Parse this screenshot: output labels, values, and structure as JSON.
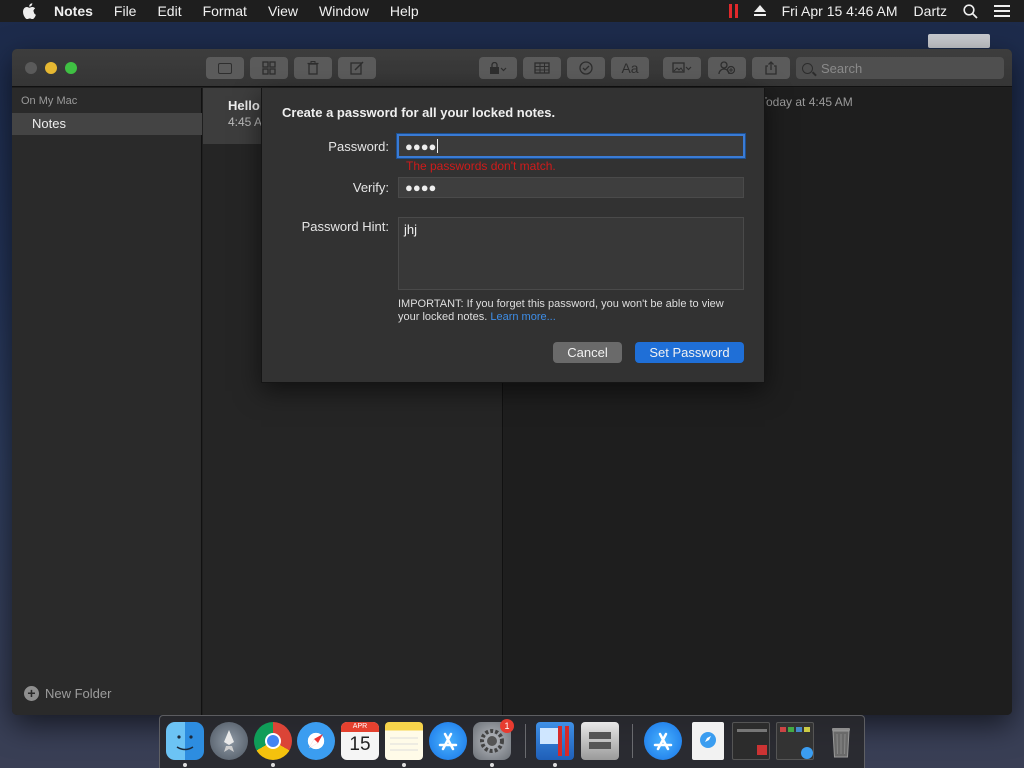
{
  "menubar": {
    "app_name": "Notes",
    "items": [
      "File",
      "Edit",
      "Format",
      "View",
      "Window",
      "Help"
    ],
    "clock": "Fri Apr 15  4:46 AM",
    "user": "Dartz"
  },
  "sidebar": {
    "section": "On My Mac",
    "selected_folder": "Notes",
    "new_folder": "New Folder"
  },
  "toolbar": {
    "search_placeholder": "Search"
  },
  "note_list": [
    {
      "title": "Hello",
      "time": "4:45 AM"
    }
  ],
  "editor": {
    "date": "Today at 4:45 AM"
  },
  "dialog": {
    "heading": "Create a password for all your locked notes.",
    "password_label": "Password:",
    "password_value": "●●●●",
    "error": "The passwords don't match.",
    "verify_label": "Verify:",
    "verify_value": "●●●●",
    "hint_label": "Password Hint:",
    "hint_value": "jhj",
    "important": "IMPORTANT: If you forget this password, you won't be able to view your locked notes.",
    "learn_more": "Learn more...",
    "cancel": "Cancel",
    "set_password": "Set Password"
  },
  "dock": {
    "calendar_month": "APR",
    "calendar_day": "15",
    "prefs_badge": "1",
    "apps": [
      "finder-icon",
      "launchpad-icon",
      "chrome-icon",
      "safari-icon",
      "calendar-icon",
      "notes-icon",
      "app-store-icon",
      "system-preferences-icon",
      "screen-recorder-icon",
      "disk-utility-icon",
      "app-store-folder-icon",
      "download-icon",
      "window-preview-icon",
      "mission-control-icon",
      "trash-icon"
    ]
  },
  "colors": {
    "accent": "#1f6fd7",
    "error": "#d01b1b",
    "traffic_min": "#e6b832",
    "traffic_max": "#3fc043"
  }
}
